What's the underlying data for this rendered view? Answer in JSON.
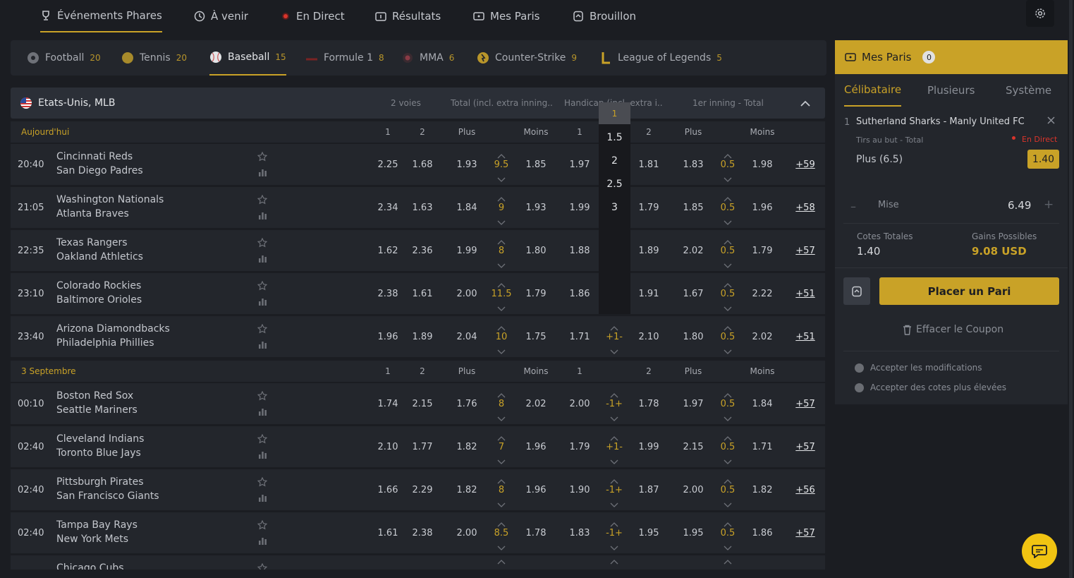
{
  "topnav": {
    "tabs": [
      {
        "label": "Événements Phares",
        "icon": "trophy-icon",
        "active": true
      },
      {
        "label": "À venir",
        "icon": "clock-icon"
      },
      {
        "label": "En Direct",
        "icon": "live-dot-icon"
      },
      {
        "label": "Résultats",
        "icon": "scoreboard-icon"
      },
      {
        "label": "Mes Paris",
        "icon": "ticket-icon"
      },
      {
        "label": "Brouillon",
        "icon": "draft-icon"
      }
    ]
  },
  "sports": [
    {
      "label": "Football",
      "count": "20",
      "icon": "football-icon"
    },
    {
      "label": "Tennis",
      "count": "20",
      "icon": "tennis-ball-icon"
    },
    {
      "label": "Baseball",
      "count": "15",
      "icon": "baseball-icon",
      "active": true
    },
    {
      "label": "Formule 1",
      "count": "8",
      "icon": "formula1-icon"
    },
    {
      "label": "MMA",
      "count": "6",
      "icon": "mma-icon"
    },
    {
      "label": "Counter-Strike",
      "count": "9",
      "icon": "counter-strike-icon"
    },
    {
      "label": "League of Legends",
      "count": "5",
      "icon": "league-of-legends-icon"
    }
  ],
  "league": {
    "name": "Etats-Unis, MLB",
    "headers": [
      "2 voies",
      "Total (incl. extra inning...",
      "Handicap (incl. extra i...",
      "1er inning - Total"
    ]
  },
  "sections": [
    {
      "title": "Aujourd'hui",
      "cols": [
        "1",
        "2",
        "Plus",
        "Moins",
        "1",
        "2",
        "Plus",
        "Moins"
      ],
      "matches": [
        {
          "time": "20:40",
          "home": "Cincinnati Reds",
          "away": "San Diego Padres",
          "o1": "2.25",
          "o2": "1.68",
          "tplus": "1.93",
          "tline": "9.5",
          "tminus": "1.85",
          "h1": "1.97",
          "hline": "",
          "h2": "1.81",
          "fplus": "1.83",
          "fline": "0.5",
          "fminus": "1.98",
          "more": "+59"
        },
        {
          "time": "21:05",
          "home": "Washington Nationals",
          "away": "Atlanta Braves",
          "o1": "2.34",
          "o2": "1.63",
          "tplus": "1.84",
          "tline": "9",
          "tminus": "1.93",
          "h1": "1.99",
          "hline": "",
          "h2": "1.79",
          "fplus": "1.85",
          "fline": "0.5",
          "fminus": "1.96",
          "more": "+58"
        },
        {
          "time": "22:35",
          "home": "Texas Rangers",
          "away": "Oakland Athletics",
          "o1": "1.62",
          "o2": "2.36",
          "tplus": "1.99",
          "tline": "8",
          "tminus": "1.80",
          "h1": "1.88",
          "hline": "",
          "h2": "1.89",
          "fplus": "2.02",
          "fline": "0.5",
          "fminus": "1.79",
          "more": "+57"
        },
        {
          "time": "23:10",
          "home": "Colorado Rockies",
          "away": "Baltimore Orioles",
          "o1": "2.38",
          "o2": "1.61",
          "tplus": "2.00",
          "tline": "11.5",
          "tminus": "1.79",
          "h1": "1.86",
          "hline": "",
          "h2": "1.91",
          "fplus": "1.67",
          "fline": "0.5",
          "fminus": "2.22",
          "more": "+51"
        },
        {
          "time": "23:40",
          "home": "Arizona Diamondbacks",
          "away": "Philadelphia Phillies",
          "o1": "1.96",
          "o2": "1.89",
          "tplus": "2.04",
          "tline": "10",
          "tminus": "1.75",
          "h1": "1.71",
          "hline": "+1-",
          "h2": "2.10",
          "fplus": "1.80",
          "fline": "0.5",
          "fminus": "2.02",
          "more": "+51"
        }
      ]
    },
    {
      "title": "3 Septembre",
      "cols": [
        "1",
        "2",
        "Plus",
        "Moins",
        "1",
        "2",
        "Plus",
        "Moins"
      ],
      "matches": [
        {
          "time": "00:10",
          "home": "Boston Red Sox",
          "away": "Seattle Mariners",
          "o1": "1.74",
          "o2": "2.15",
          "tplus": "1.76",
          "tline": "8",
          "tminus": "2.02",
          "h1": "2.00",
          "hline": "-1+",
          "h2": "1.78",
          "fplus": "1.97",
          "fline": "0.5",
          "fminus": "1.84",
          "more": "+57"
        },
        {
          "time": "02:40",
          "home": "Cleveland Indians",
          "away": "Toronto Blue Jays",
          "o1": "2.10",
          "o2": "1.77",
          "tplus": "1.82",
          "tline": "7",
          "tminus": "1.96",
          "h1": "1.79",
          "hline": "+1-",
          "h2": "1.99",
          "fplus": "2.15",
          "fline": "0.5",
          "fminus": "1.71",
          "more": "+57"
        },
        {
          "time": "02:40",
          "home": "Pittsburgh Pirates",
          "away": "San Francisco Giants",
          "o1": "1.66",
          "o2": "2.29",
          "tplus": "1.82",
          "tline": "8",
          "tminus": "1.96",
          "h1": "1.90",
          "hline": "-1+",
          "h2": "1.87",
          "fplus": "2.00",
          "fline": "0.5",
          "fminus": "1.82",
          "more": "+56"
        },
        {
          "time": "02:40",
          "home": "Tampa Bay Rays",
          "away": "New York Mets",
          "o1": "1.61",
          "o2": "2.38",
          "tplus": "2.00",
          "tline": "8.5",
          "tminus": "1.78",
          "h1": "1.83",
          "hline": "-1+",
          "h2": "1.95",
          "fplus": "1.95",
          "fline": "0.5",
          "fminus": "1.86",
          "more": "+57"
        },
        {
          "time": "",
          "home": "Chicago Cubs",
          "away": "",
          "o1": "",
          "o2": "",
          "tplus": "",
          "tline": "",
          "tminus": "",
          "h1": "",
          "hline": "",
          "h2": "",
          "fplus": "",
          "fline": "",
          "fminus": "",
          "more": ""
        }
      ]
    }
  ],
  "handicap_dropdown": {
    "options": [
      "1",
      "1.5",
      "2",
      "2.5",
      "3"
    ],
    "selected": "1"
  },
  "betslip": {
    "title": "Mes Paris",
    "count": "0",
    "tabs": [
      "Célibataire",
      "Plusieurs",
      "Système"
    ],
    "bet": {
      "index": "1",
      "event": "Sutherland Sharks - Manly United FC",
      "market": "Tirs au but - Total",
      "live": "En Direct",
      "selection": "Plus (6.5)",
      "odds": "1.40"
    },
    "stake_label": "Mise",
    "stake_value": "6.49",
    "total_odds_label": "Cotes Totales",
    "total_odds": "1.40",
    "possible_win_label": "Gains Possibles",
    "possible_win": "9.08 USD",
    "place_bet": "Placer un Pari",
    "clear": "Effacer le Coupon",
    "options": [
      "Accepter les modifications",
      "Accepter des cotes plus élevées"
    ]
  },
  "colors": {
    "accent": "#c9a227",
    "live": "#d9342b",
    "bg": "#1b1d22",
    "panel": "#23262c"
  }
}
